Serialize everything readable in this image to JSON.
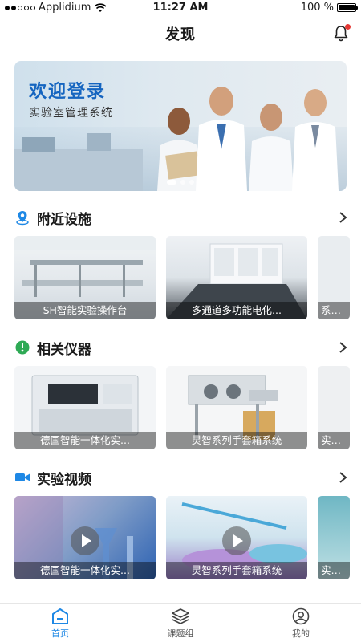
{
  "status_bar": {
    "carrier": "Applidium",
    "time": "11:27 AM",
    "battery": "100 %"
  },
  "header": {
    "title": "发现",
    "bell_icon": "bell-icon"
  },
  "banner": {
    "title": "欢迎登录",
    "subtitle": "实验室管理系统",
    "slides": 3,
    "active_slide": 0
  },
  "sections": {
    "facilities": {
      "title": "附近设施",
      "icon": "location-pin-icon",
      "items": [
        {
          "caption": "SH智能实验操作台"
        },
        {
          "caption": "多通道多功能电化..."
        },
        {
          "caption": "系列手"
        }
      ]
    },
    "instruments": {
      "title": "相关仪器",
      "icon": "instrument-icon",
      "items": [
        {
          "caption": "德国智能一体化实..."
        },
        {
          "caption": "灵智系列手套箱系统"
        },
        {
          "caption": "实验室"
        }
      ]
    },
    "videos": {
      "title": "实验视频",
      "icon": "video-camera-icon",
      "items": [
        {
          "caption": "德国智能一体化实..."
        },
        {
          "caption": "灵智系列手套箱系统"
        },
        {
          "caption": "实验室"
        }
      ]
    }
  },
  "tabbar": {
    "items": [
      {
        "label": "首页",
        "icon": "home-icon",
        "active": true
      },
      {
        "label": "课题组",
        "icon": "layers-icon",
        "active": false
      },
      {
        "label": "我的",
        "icon": "user-icon",
        "active": false
      }
    ]
  },
  "colors": {
    "accent": "#1e88e5",
    "banner_title": "#1565c0",
    "badge": "#e53935"
  }
}
